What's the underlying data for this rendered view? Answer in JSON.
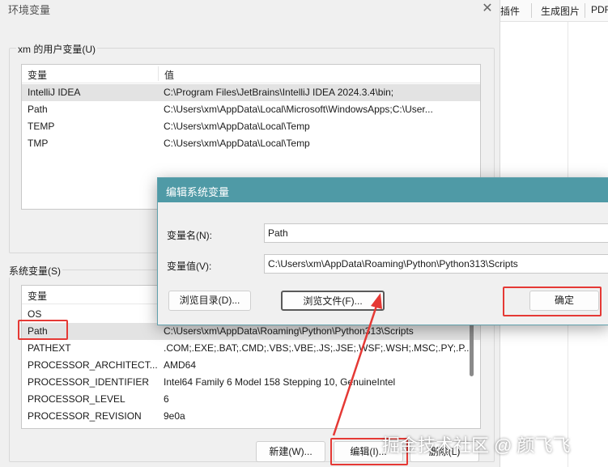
{
  "background_app": {
    "toolbar_items": [
      "插件",
      "生成图片",
      "PDF"
    ]
  },
  "env_dialog": {
    "title": "环境变量",
    "close_glyph": "✕",
    "user_vars": {
      "group_label": "xm 的用户变量(U)",
      "col_variable": "变量",
      "col_value": "值",
      "rows": [
        {
          "name": "IntelliJ IDEA",
          "value": "C:\\Program Files\\JetBrains\\IntelliJ IDEA 2024.3.4\\bin;"
        },
        {
          "name": "Path",
          "value": "C:\\Users\\xm\\AppData\\Local\\Microsoft\\WindowsApps;C:\\User..."
        },
        {
          "name": "TEMP",
          "value": "C:\\Users\\xm\\AppData\\Local\\Temp"
        },
        {
          "name": "TMP",
          "value": "C:\\Users\\xm\\AppData\\Local\\Temp"
        }
      ]
    },
    "system_vars": {
      "group_label": "系统变量(S)",
      "col_variable": "变量",
      "rows": [
        {
          "name": "OS",
          "value": ""
        },
        {
          "name": "Path",
          "value": "C:\\Users\\xm\\AppData\\Roaming\\Python\\Python313\\Scripts"
        },
        {
          "name": "PATHEXT",
          "value": ".COM;.EXE;.BAT;.CMD;.VBS;.VBE;.JS;.JSE;.WSF;.WSH;.MSC;.PY;.P..."
        },
        {
          "name": "PROCESSOR_ARCHITECT...",
          "value": "AMD64"
        },
        {
          "name": "PROCESSOR_IDENTIFIER",
          "value": "Intel64 Family 6 Model 158 Stepping 10, GenuineIntel"
        },
        {
          "name": "PROCESSOR_LEVEL",
          "value": "6"
        },
        {
          "name": "PROCESSOR_REVISION",
          "value": "9e0a"
        }
      ],
      "buttons": {
        "new": "新建(W)...",
        "edit": "编辑(I)...",
        "delete": "删除(L)"
      }
    }
  },
  "edit_dialog": {
    "title": "编辑系统变量",
    "name_label": "变量名(N):",
    "name_value": "Path",
    "value_label": "变量值(V):",
    "value_value": "C:\\Users\\xm\\AppData\\Roaming\\Python\\Python313\\Scripts",
    "browse_dir": "浏览目录(D)...",
    "browse_file": "浏览文件(F)...",
    "ok": "确定"
  },
  "watermark": "掘金技术社区 @ 颜飞飞",
  "colors": {
    "annotation": "#e53935",
    "dialog_title_bar": "#4f9aa6"
  }
}
